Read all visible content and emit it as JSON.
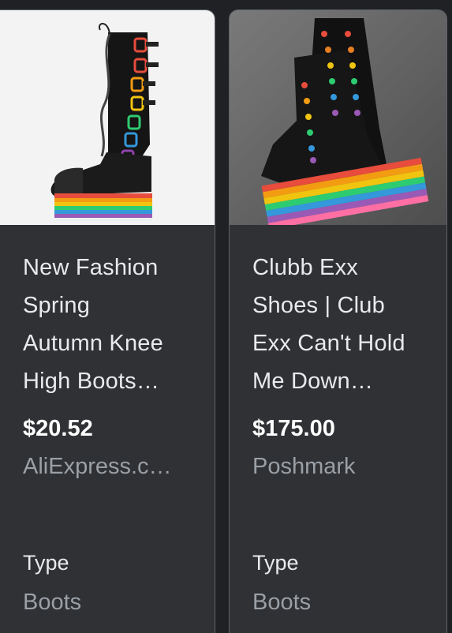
{
  "products": [
    {
      "title": "New Fashion\nSpring\nAutumn Knee\nHigh Boots…",
      "price": "$20.52",
      "source": "AliExpress.c…",
      "type_label": "Type",
      "type_value": "Boots",
      "image_icon": "knee-high-rainbow-platform-boot"
    },
    {
      "title": "Clubb Exx\nShoes | Club\nExx Can't Hold\nMe Down…",
      "price": "$175.00",
      "source": "Poshmark",
      "type_label": "Type",
      "type_value": "Boots",
      "image_icon": "rainbow-platform-ankle-boots"
    }
  ],
  "colors": {
    "background": "#202124",
    "card": "#303134",
    "card_border": "#5f6368",
    "title_text": "#e8eaed",
    "muted_text": "#9aa0a6",
    "price_text": "#ffffff"
  }
}
